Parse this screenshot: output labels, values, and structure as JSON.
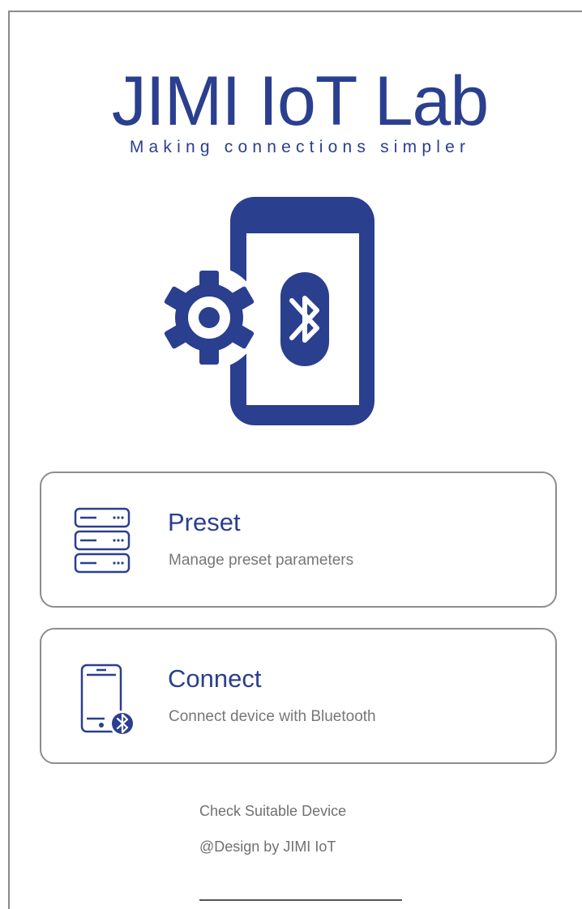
{
  "header": {
    "title": "JIMI IoT Lab",
    "subtitle": "Making connections simpler"
  },
  "hero": {
    "icon": "phone-gear-bluetooth-icon"
  },
  "menu": [
    {
      "title": "Preset",
      "description": "Manage preset parameters",
      "icon": "server-stack-icon"
    },
    {
      "title": "Connect",
      "description": "Connect device with Bluetooth",
      "icon": "phone-bluetooth-icon"
    }
  ],
  "footer": {
    "check_device": "Check Suitable Device",
    "credit": "@Design by JIMI IoT"
  },
  "colors": {
    "brand": "#2b3f8f",
    "secondary_text": "#777777",
    "border": "#8d8d8d"
  }
}
